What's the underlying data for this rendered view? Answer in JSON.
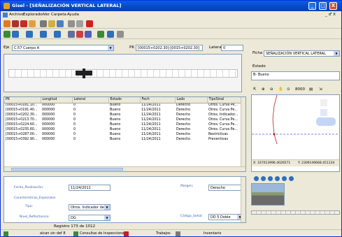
{
  "window": {
    "title": "Gisel - [SEÑALIZACIÓN VERTICAL LATERAL]",
    "min": "_",
    "max": "□",
    "close": "X",
    "mdi_controls": "_ ♂ X"
  },
  "menu": [
    "Archivo",
    "Explorador",
    "Ver",
    "Carpeta",
    "Ayuda"
  ],
  "filter": {
    "eje_label": "Eje",
    "eje_value": "C:57 Cuerpo A",
    "pk_label": "PK",
    "pk_value": "[00015+0202.30]-[0015+0202.30]",
    "lateral_label": "Lateral",
    "lateral_value": "0"
  },
  "right_panel": {
    "ficha_label": "Ficha",
    "ficha_value": "SEÑALIZACIÓN VERTICAL LATERAL",
    "estado_label": "Estado",
    "estado_value": "B- Bueno",
    "scale_label": "8000",
    "coords_x": "X: 337013996.4026571",
    "coords_y": "Y: 2309149668.451134"
  },
  "table": {
    "headers": [
      "PK",
      "Longitud",
      "Lateral",
      "Estado",
      "Fech",
      "Lado",
      "TipoSinal"
    ],
    "rows": [
      [
        "[00015+0181.10...",
        "000000",
        "0",
        "Bueno",
        "11/24/2011",
        "Derecho",
        "Otros. Curva Pe..."
      ],
      [
        "[00015+0191.40...",
        "000000",
        "0",
        "Bueno",
        "11/24/2011",
        "Derecho",
        "Otros. Curva Pe..."
      ],
      [
        "[00015+0202.30...",
        "000000",
        "0",
        "Bueno",
        "11/24/2011",
        "Derecho",
        "Otros. Indicador..."
      ],
      [
        "[00015+0213.70...",
        "000000",
        "0",
        "Bueno",
        "11/24/2011",
        "Derecho",
        "Otros. Curva Pe..."
      ],
      [
        "[00015+0224.60...",
        "000000",
        "0",
        "Bueno",
        "11/24/2011",
        "Derecho",
        "Otros. Curva Pe..."
      ],
      [
        "[00015+0235.60...",
        "000000",
        "0",
        "Bueno",
        "11/24/2011",
        "Derecho",
        "Otros. Curva Pe..."
      ],
      [
        "[00015+0287.00...",
        "000000",
        "0",
        "Bueno",
        "11/24/2011",
        "Derecho",
        "Restrictivas"
      ],
      [
        "[00015+0392.90...",
        "000000",
        "0",
        "Bueno",
        "11/24/2011",
        "Derecho",
        "Preventivas"
      ]
    ]
  },
  "form": {
    "fecha_label": "Fecha_Realización:",
    "fecha_value": "11/24/2011",
    "margen_label": "Margen:",
    "margen_value": "Derecho",
    "caract_label": "Características_Especiales",
    "tipo_label": "Tipo:",
    "tipo_value": "Otros. Indicador de",
    "nivel_label": "Nivel_Reflectancia:",
    "nivel_value": "DG",
    "codigo_label": "Código_Señal:",
    "codigo_value": "DD 5 Doble"
  },
  "record_info": "Registro 173 de 1012",
  "status": {
    "left": "alcan sin def 8",
    "consultas": "Consultas de Inspecciones",
    "trabajos": "Trabajos",
    "inventario": "Inventario"
  }
}
